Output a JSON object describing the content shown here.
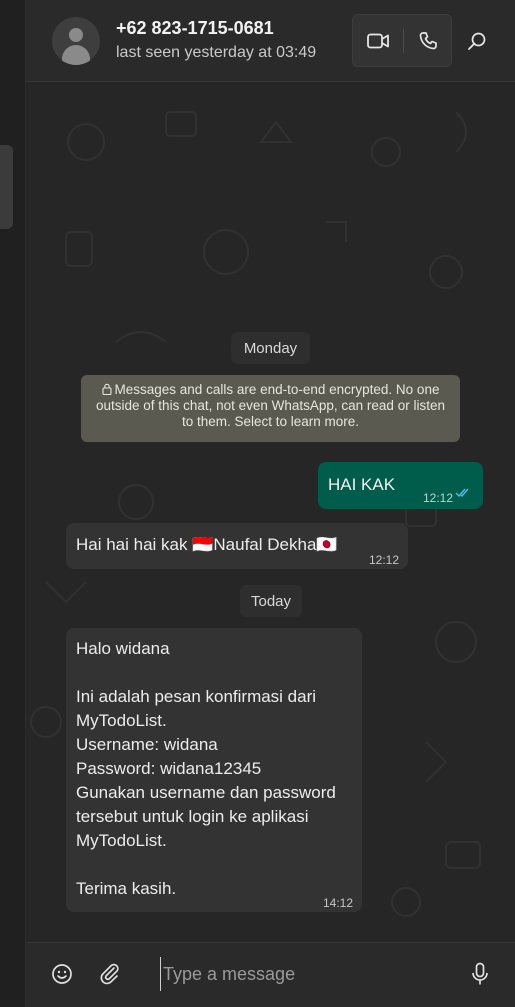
{
  "header": {
    "contact_name": "+62 823-1715-0681",
    "last_seen": "last seen yesterday at 03:49",
    "avatar_icon": "default-user-avatar",
    "video_icon": "video-camera-icon",
    "voice_icon": "phone-icon",
    "search_icon": "search-icon"
  },
  "chat": {
    "date_monday": "Monday",
    "encryption_notice": "Messages and calls are end-to-end encrypted. No one outside of this chat, not even WhatsApp, can read or listen to them. Select to learn more.",
    "messages": [
      {
        "direction": "out",
        "text": "HAI KAK",
        "time": "12:12",
        "status": "read"
      },
      {
        "direction": "in",
        "text": "Hai hai hai kak 🇮🇩Naufal Dekha🇯🇵",
        "time": "12:12"
      },
      {
        "direction": "in",
        "text": "Halo widana\n\nIni adalah pesan konfirmasi dari\nMyTodoList.\nUsername: widana\nPassword: widana12345\nGunakan username dan password\ntersebut untuk login ke aplikasi\nMyTodoList.\n\nTerima kasih.",
        "time": "14:12"
      }
    ],
    "date_today": "Today"
  },
  "composer": {
    "placeholder": "Type a message",
    "emoji_icon": "emoji-icon",
    "attach_icon": "paperclip-icon",
    "mic_icon": "microphone-icon"
  },
  "colors": {
    "outgoing_bubble": "#005c4b",
    "incoming_bubble": "#333333",
    "read_ticks": "#53bdeb",
    "notice_bg": "#5b5a50"
  }
}
